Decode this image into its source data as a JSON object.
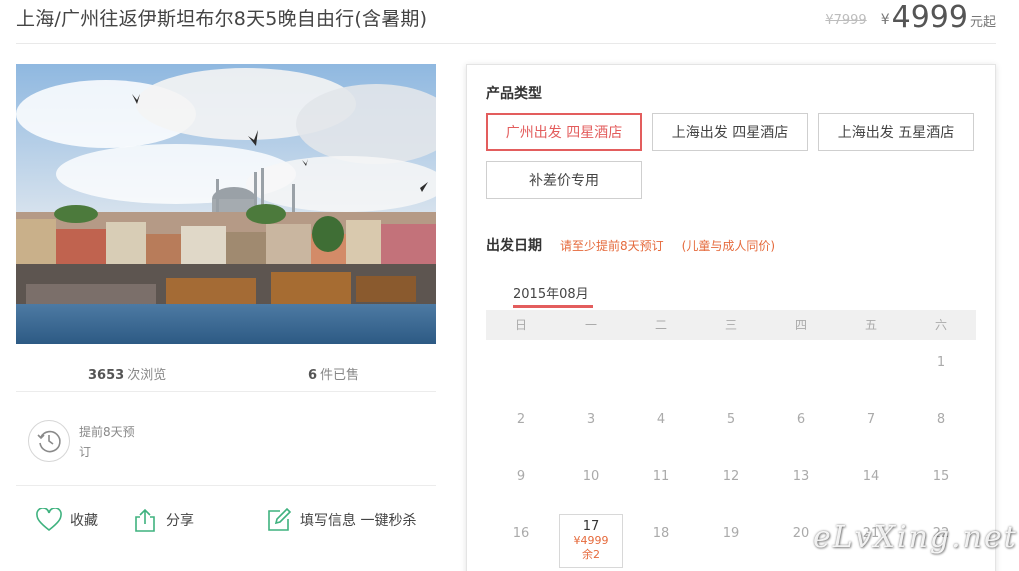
{
  "header": {
    "title": "上海/广州往返伊斯坦布尔8天5晚自由行(含暑期)",
    "original_price": "¥7999",
    "currency": "¥",
    "price": "4999",
    "price_suffix": "元起"
  },
  "stats": {
    "views_count": "3653",
    "views_label": "次浏览",
    "sold_count": "6",
    "sold_label": "件已售"
  },
  "advance": {
    "text": "提前8天预订",
    "icon": "clock-history-icon"
  },
  "actions": {
    "favorite": "收藏",
    "share": "分享",
    "fill_info": "填写信息 一键秒杀"
  },
  "product_type": {
    "title": "产品类型",
    "options": [
      "广州出发 四星酒店",
      "上海出发 四星酒店",
      "上海出发 五星酒店",
      "补差价专用"
    ],
    "selected_index": 0
  },
  "departure": {
    "title": "出发日期",
    "hint_advance": "请至少提前8天预订",
    "hint_child": "(儿童与成人同价)",
    "month": "2015年08月",
    "weekdays": [
      "日",
      "一",
      "二",
      "三",
      "四",
      "五",
      "六"
    ],
    "rows": [
      [
        null,
        null,
        null,
        null,
        null,
        null,
        {
          "day": "1"
        }
      ],
      [
        {
          "day": "2"
        },
        {
          "day": "3"
        },
        {
          "day": "4"
        },
        {
          "day": "5"
        },
        {
          "day": "6"
        },
        {
          "day": "7"
        },
        {
          "day": "8"
        }
      ],
      [
        {
          "day": "9"
        },
        {
          "day": "10"
        },
        {
          "day": "11"
        },
        {
          "day": "12"
        },
        {
          "day": "13"
        },
        {
          "day": "14"
        },
        {
          "day": "15"
        }
      ],
      [
        {
          "day": "16"
        },
        {
          "day": "17",
          "price": "¥4999",
          "remain": "余2"
        },
        {
          "day": "18"
        },
        {
          "day": "19"
        },
        {
          "day": "20"
        },
        {
          "day": "21"
        },
        {
          "day": "22"
        }
      ]
    ]
  },
  "watermark": "eLvXing.net",
  "colors": {
    "accent": "#e35d5d",
    "hint": "#e56a3c",
    "icon_green": "#3fb27f"
  }
}
